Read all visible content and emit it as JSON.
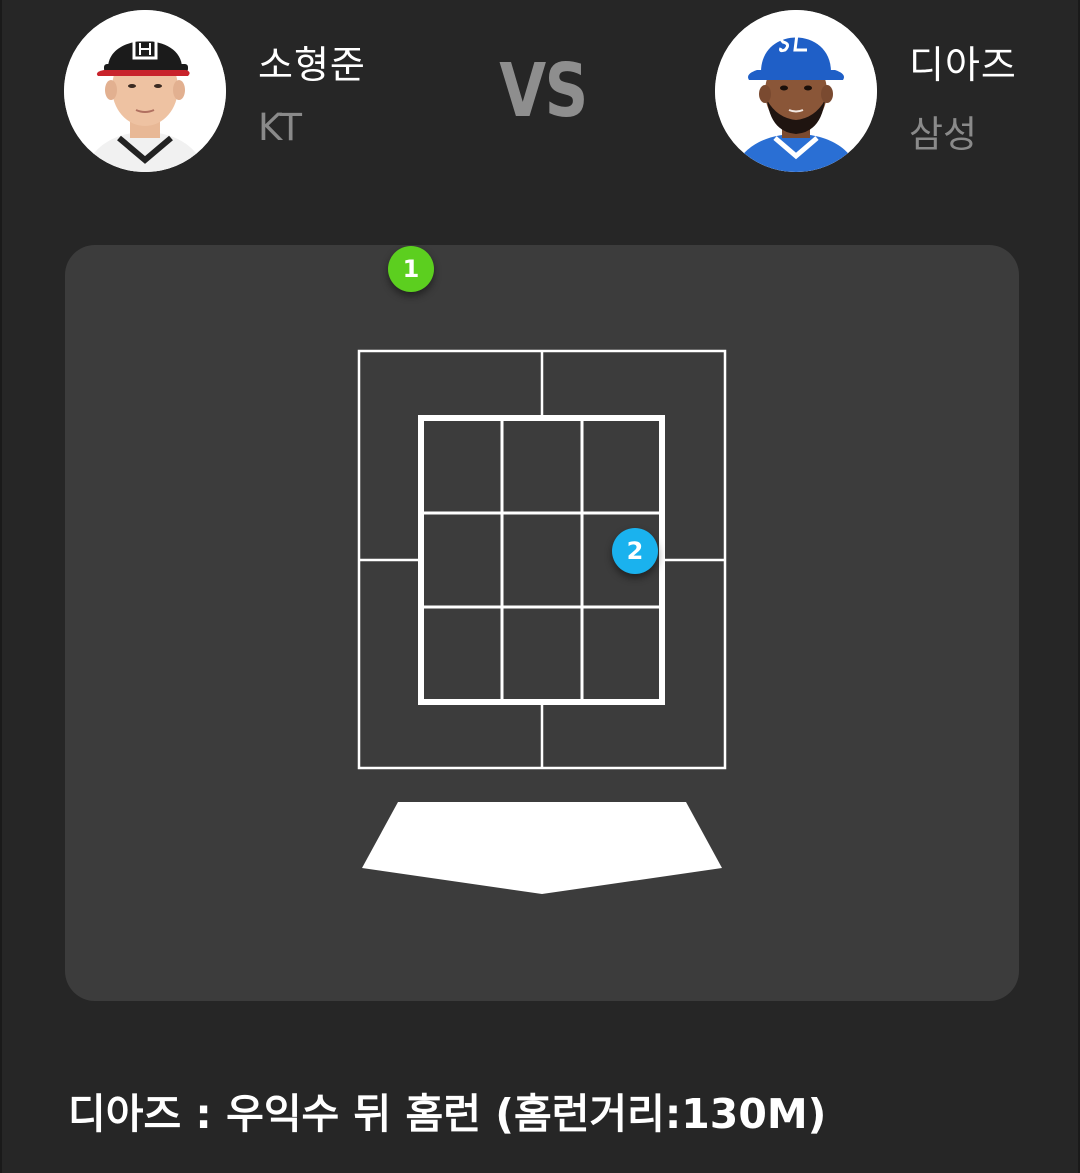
{
  "matchup": {
    "pitcher": {
      "name": "소형준",
      "team": "KT",
      "avatar_icon": "player-photo-icon",
      "cap_color": "#1b1b1b"
    },
    "vs_label": "VS",
    "batter": {
      "name": "디아즈",
      "team": "삼성",
      "avatar_icon": "player-photo-icon",
      "cap_color": "#1f5fc7"
    }
  },
  "pitch_zone": {
    "pitches": [
      {
        "number": "1",
        "color": "#5ccf1f"
      },
      {
        "number": "2",
        "color": "#1ab2ee"
      }
    ],
    "panel_color": "#3c3c3c",
    "line_color": "#ffffff"
  },
  "result": {
    "text": "디아즈 : 우익수 뒤 홈런 (홈런거리:130M)"
  }
}
